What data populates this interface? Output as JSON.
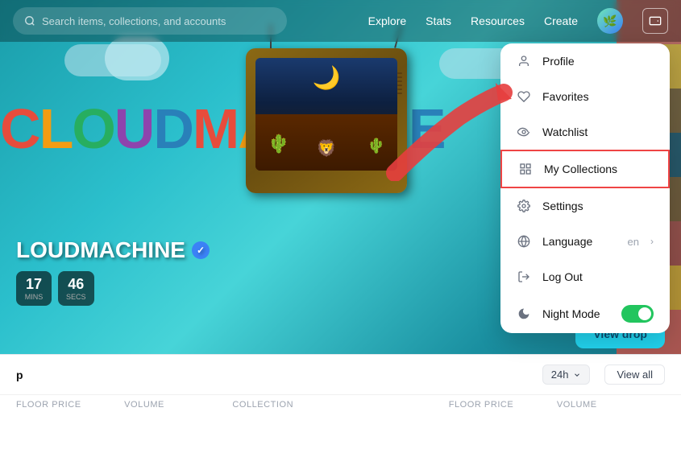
{
  "navbar": {
    "search_placeholder": "Search items, collections, and accounts",
    "links": [
      "Explore",
      "Stats",
      "Resources",
      "Create"
    ],
    "avatar_emoji": "🌿",
    "wallet_icon": "▣"
  },
  "hero": {
    "title": "LOUDMACHINE",
    "verified": true,
    "countdown": {
      "mins_label": "MINS",
      "secs_label": "SECS",
      "mins": "17",
      "secs": "46"
    },
    "view_drop_label": "View drop"
  },
  "dropdown": {
    "items": [
      {
        "id": "profile",
        "icon": "👤",
        "label": "Profile",
        "sub": "",
        "highlighted": false
      },
      {
        "id": "favorites",
        "icon": "♡",
        "label": "Favorites",
        "sub": "",
        "highlighted": false
      },
      {
        "id": "watchlist",
        "icon": "👁",
        "label": "Watchlist",
        "sub": "",
        "highlighted": false
      },
      {
        "id": "my-collections",
        "icon": "⊞",
        "label": "My Collections",
        "sub": "",
        "highlighted": true
      },
      {
        "id": "settings",
        "icon": "⚙",
        "label": "Settings",
        "sub": "",
        "highlighted": false
      },
      {
        "id": "language",
        "icon": "🌐",
        "label": "Language",
        "sub": "en",
        "highlighted": false
      },
      {
        "id": "logout",
        "icon": "→",
        "label": "Log Out",
        "sub": "",
        "highlighted": false
      },
      {
        "id": "night-mode",
        "icon": "🌙",
        "label": "Night Mode",
        "sub": "",
        "highlighted": false,
        "toggle": true
      }
    ]
  },
  "bottom_strip": {
    "filter_label": "24h",
    "view_all_label": "View all",
    "table_headers": [
      "FLOOR PRICE",
      "VOLUME",
      "COLLECTION",
      "",
      "FLOOR PRICE",
      "VOLUME"
    ]
  },
  "colors": {
    "hero_bg_start": "#1a9daa",
    "hero_bg_end": "#156e80",
    "dropdown_highlight": "#ef4444",
    "toggle_on": "#22c55e",
    "view_drop": "#22d3ee"
  }
}
